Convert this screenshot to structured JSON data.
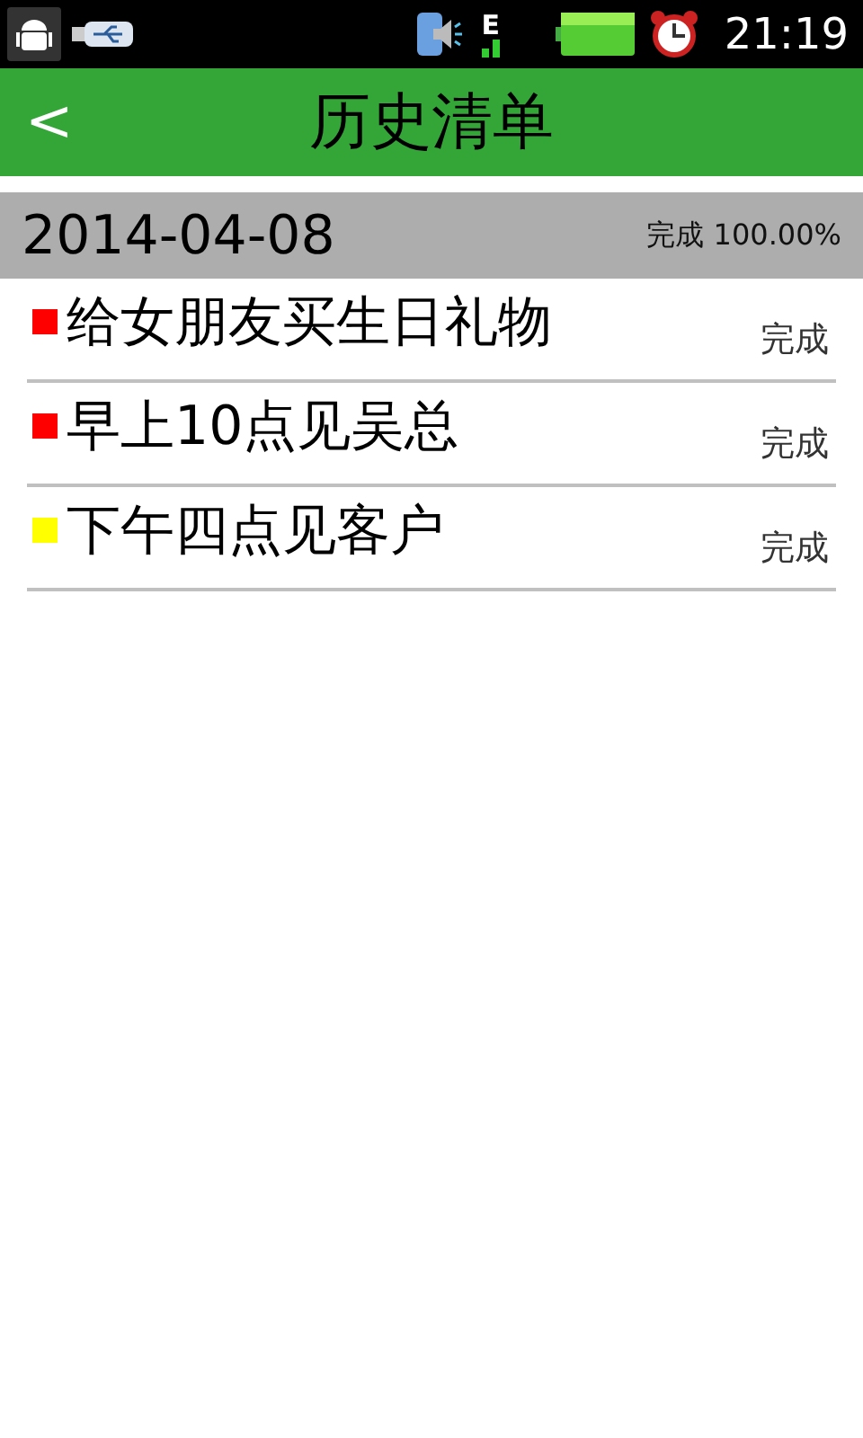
{
  "status_bar": {
    "network": "E",
    "time": "21:19"
  },
  "app_bar": {
    "back": "<",
    "title": "历史清单"
  },
  "day": {
    "date": "2014-04-08",
    "summary": "完成 100.00%"
  },
  "tasks": [
    {
      "title": "给女朋友买生日礼物",
      "status": "完成",
      "color": "#ff0000"
    },
    {
      "title": "早上10点见吴总",
      "status": "完成",
      "color": "#ff0000"
    },
    {
      "title": "下午四点见客户",
      "status": "完成",
      "color": "#ffff00"
    }
  ]
}
